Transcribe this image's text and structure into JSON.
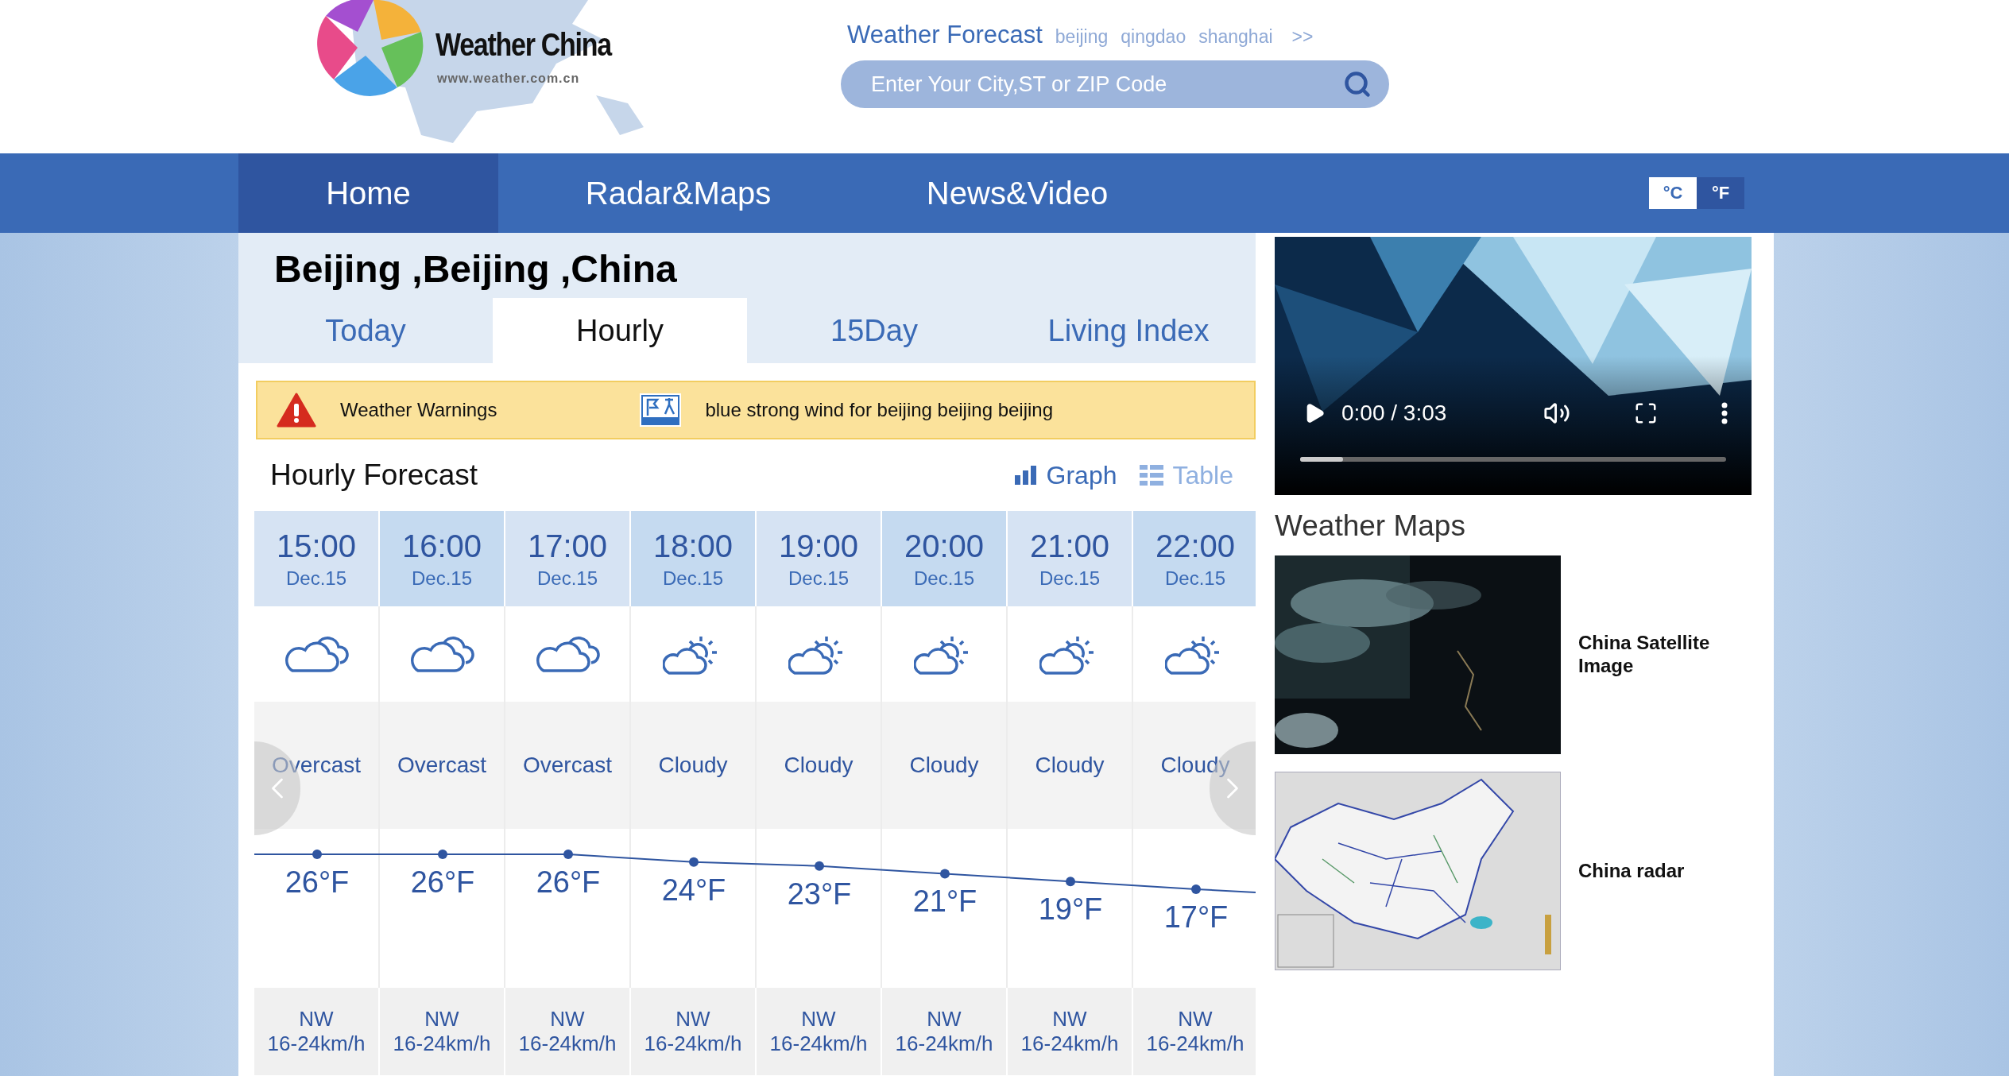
{
  "header": {
    "logo": {
      "name": "Weather China",
      "url": "www.weather.com.cn"
    },
    "forecast_label": "Weather Forecast",
    "city_links": [
      "beijing",
      "qingdao",
      "shanghai"
    ],
    "more_link": ">>",
    "search": {
      "placeholder": "Enter Your City,ST or ZIP Code"
    }
  },
  "nav": {
    "items": [
      {
        "label": "Home",
        "selected": true
      },
      {
        "label": "Radar&Maps",
        "selected": false
      },
      {
        "label": "News&Video",
        "selected": false
      }
    ],
    "units": [
      {
        "label": "°C",
        "selected": true
      },
      {
        "label": "°F",
        "selected": false
      }
    ]
  },
  "location": "Beijing ,Beijing ,China",
  "tabs": [
    {
      "label": "Today",
      "selected": false
    },
    {
      "label": "Hourly",
      "selected": true
    },
    {
      "label": "15Day",
      "selected": false
    },
    {
      "label": "Living Index",
      "selected": false
    }
  ],
  "warning": {
    "label": "Weather Warnings",
    "message": "blue strong wind for beijing beijing beijing"
  },
  "hourly": {
    "title": "Hourly Forecast",
    "views": [
      {
        "label": "Graph",
        "selected": true
      },
      {
        "label": "Table",
        "selected": false
      }
    ],
    "hours": [
      {
        "time": "15:00",
        "date": "Dec.15",
        "kind": "overcast",
        "condition": "Overcast",
        "temperature": "26°F",
        "wind_direction": "NW",
        "wind_speed": "16-24km/h"
      },
      {
        "time": "16:00",
        "date": "Dec.15",
        "kind": "overcast",
        "condition": "Overcast",
        "temperature": "26°F",
        "wind_direction": "NW",
        "wind_speed": "16-24km/h"
      },
      {
        "time": "17:00",
        "date": "Dec.15",
        "kind": "overcast",
        "condition": "Overcast",
        "temperature": "26°F",
        "wind_direction": "NW",
        "wind_speed": "16-24km/h"
      },
      {
        "time": "18:00",
        "date": "Dec.15",
        "kind": "partly_cloudy",
        "condition": "Cloudy",
        "temperature": "24°F",
        "wind_direction": "NW",
        "wind_speed": "16-24km/h"
      },
      {
        "time": "19:00",
        "date": "Dec.15",
        "kind": "partly_cloudy",
        "condition": "Cloudy",
        "temperature": "23°F",
        "wind_direction": "NW",
        "wind_speed": "16-24km/h"
      },
      {
        "time": "20:00",
        "date": "Dec.15",
        "kind": "partly_cloudy",
        "condition": "Cloudy",
        "temperature": "21°F",
        "wind_direction": "NW",
        "wind_speed": "16-24km/h"
      },
      {
        "time": "21:00",
        "date": "Dec.15",
        "kind": "partly_cloudy",
        "condition": "Cloudy",
        "temperature": "19°F",
        "wind_direction": "NW",
        "wind_speed": "16-24km/h"
      },
      {
        "time": "22:00",
        "date": "Dec.15",
        "kind": "partly_cloudy",
        "condition": "Cloudy",
        "temperature": "17°F",
        "wind_direction": "NW",
        "wind_speed": "16-24km/h"
      }
    ]
  },
  "video": {
    "time": "0:00 / 3:03",
    "level": 0.1
  },
  "maps": {
    "title": "Weather Maps",
    "items": [
      {
        "kind": "satellite",
        "caption": "China Satellite Image"
      },
      {
        "kind": "radar",
        "caption": "China radar"
      }
    ]
  }
}
